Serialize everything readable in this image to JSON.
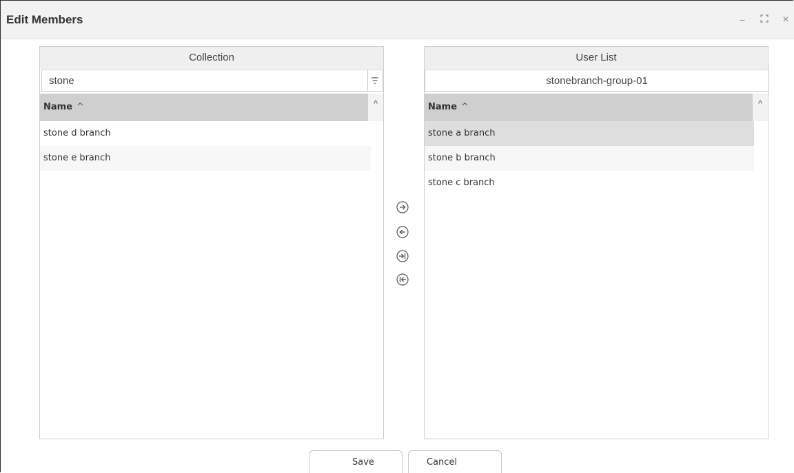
{
  "window": {
    "title": "Edit Members",
    "controls": {
      "minimize": "–",
      "maximize": "⛶",
      "close": "×"
    }
  },
  "left_panel": {
    "header": "Collection",
    "search_value": "stone",
    "filter_icon": "filter-icon",
    "column": {
      "label": "Name",
      "sort": "^"
    },
    "rows": [
      "stone d branch",
      "stone e branch"
    ]
  },
  "right_panel": {
    "header": "User List",
    "group_value": "stonebranch-group-01",
    "column": {
      "label": "Name",
      "sort": "^"
    },
    "rows": [
      "stone a branch",
      "stone b branch",
      "stone c branch"
    ]
  },
  "transfer_buttons": [
    "move-right-icon",
    "move-left-icon",
    "move-all-right-icon",
    "move-all-left-icon"
  ],
  "footer": {
    "save_label": "Save",
    "cancel_label": "Cancel"
  }
}
